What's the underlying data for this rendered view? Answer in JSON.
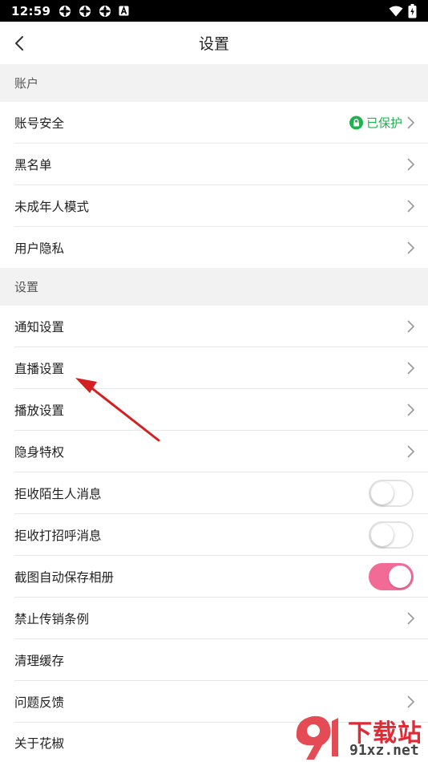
{
  "status_bar": {
    "time": "12:59"
  },
  "header": {
    "title": "设置"
  },
  "sections": {
    "account": "账户",
    "settings": "设置"
  },
  "account_rows": [
    {
      "label": "账号安全",
      "status": "已保护"
    },
    {
      "label": "黑名单"
    },
    {
      "label": "未成年人模式"
    },
    {
      "label": "用户隐私"
    }
  ],
  "settings_rows": [
    {
      "label": "通知设置"
    },
    {
      "label": "直播设置"
    },
    {
      "label": "播放设置"
    },
    {
      "label": "隐身特权"
    },
    {
      "label": "拒收陌生人消息",
      "toggle": false
    },
    {
      "label": "拒收打招呼消息",
      "toggle": false
    },
    {
      "label": "截图自动保存相册",
      "toggle": true
    },
    {
      "label": "禁止传销条例"
    },
    {
      "label": "清理缓存"
    },
    {
      "label": "问题反馈"
    },
    {
      "label": "关于花椒"
    }
  ],
  "watermark": {
    "brand": "下载站",
    "site": "91xz.net"
  },
  "colors": {
    "accent": "#f26a96",
    "protected_green": "#1fb24f",
    "annotation_arrow": "#d42020"
  }
}
